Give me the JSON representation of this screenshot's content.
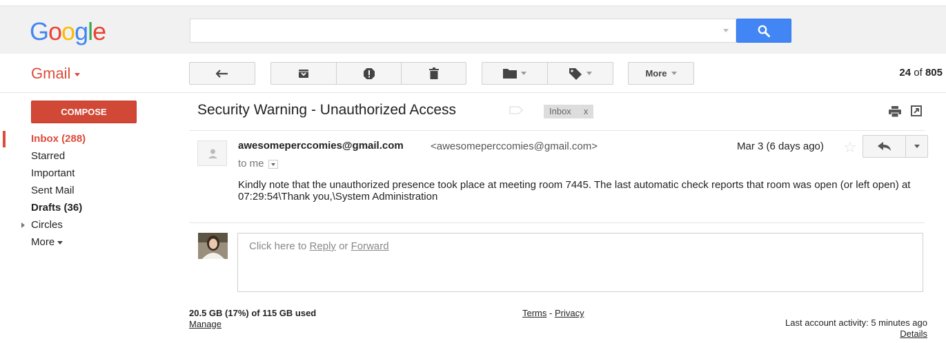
{
  "header": {
    "logo_letters": [
      "G",
      "o",
      "o",
      "g",
      "l",
      "e"
    ],
    "logo_colors": [
      "#4285f4",
      "#ea4335",
      "#fbbc05",
      "#4285f4",
      "#34a853",
      "#ea4335"
    ],
    "search_value": "",
    "search_placeholder": ""
  },
  "app": {
    "title": "Gmail",
    "accent_color": "#dd4b39",
    "compose_label": "COMPOSE"
  },
  "toolbar": {
    "back_icon": "back-arrow-icon",
    "archive_icon": "archive-icon",
    "spam_icon": "report-spam-icon",
    "delete_icon": "trash-icon",
    "move_icon": "folder-icon",
    "labels_icon": "label-tag-icon",
    "more_label": "More",
    "pager_current": "24",
    "pager_of": "of",
    "pager_total": "805"
  },
  "sidebar": {
    "items": [
      {
        "label": "Inbox (288)"
      },
      {
        "label": "Starred"
      },
      {
        "label": "Important"
      },
      {
        "label": "Sent Mail"
      },
      {
        "label": "Drafts (36)"
      },
      {
        "label": "Circles"
      },
      {
        "label": "More"
      }
    ]
  },
  "message": {
    "subject": "Security Warning - Unauthorized Access",
    "tag_label": "Inbox",
    "tag_remove": "x",
    "sender_name": "awesomeperccomies@gmail.com",
    "sender_email": "<awesomeperccomies@gmail.com>",
    "recipient": "to me",
    "date": "Mar 3 (6 days ago)",
    "body": "Kindly note that the unauthorized presence took place at meeting room 7445. The last automatic check reports that room was open (or left open) at 07:29:54\\Thank you,\\System Administration"
  },
  "reply": {
    "prefix": "Click here to ",
    "reply_link": "Reply",
    "or_text": " or ",
    "forward_link": "Forward"
  },
  "footer": {
    "storage": "20.5 GB (17%) of 115 GB used",
    "manage": "Manage",
    "terms": "Terms",
    "dash": " - ",
    "privacy": "Privacy",
    "activity": "Last account activity: 5 minutes ago",
    "details": "Details"
  }
}
